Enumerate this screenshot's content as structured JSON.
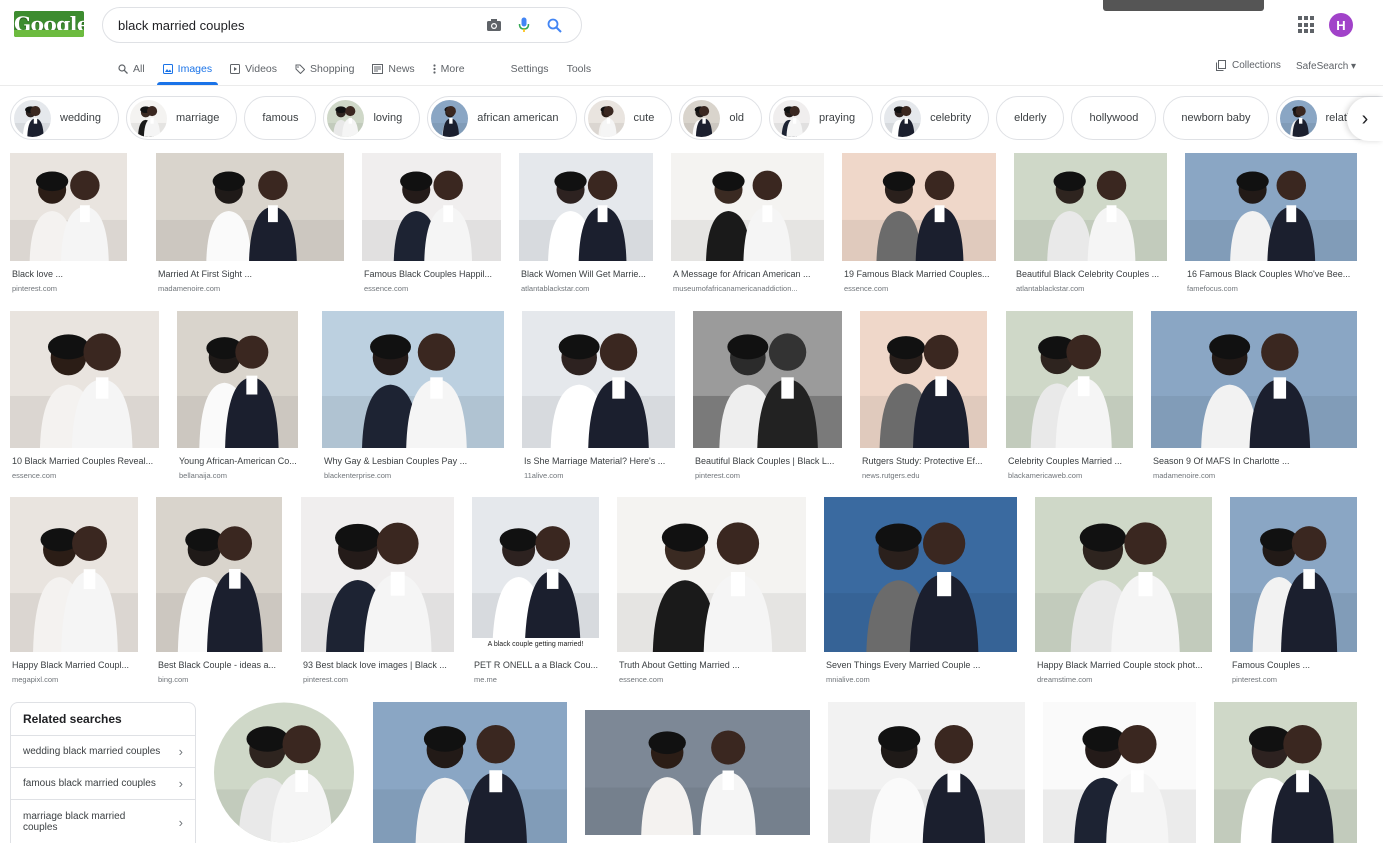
{
  "logo_text": "Google",
  "search": {
    "query": "black married couples"
  },
  "avatar_letter": "H",
  "tabs": [
    {
      "label": "All",
      "icon": "search-icon"
    },
    {
      "label": "Images",
      "icon": "image-icon"
    },
    {
      "label": "Videos",
      "icon": "video-icon"
    },
    {
      "label": "Shopping",
      "icon": "tag-icon"
    },
    {
      "label": "News",
      "icon": "news-icon"
    },
    {
      "label": "More",
      "icon": "more-icon"
    },
    {
      "label": "Settings"
    },
    {
      "label": "Tools"
    }
  ],
  "toolbar": {
    "collections": "Collections",
    "safesearch": "SafeSearch ▾"
  },
  "chips": [
    {
      "label": "wedding",
      "thumb": true
    },
    {
      "label": "marriage",
      "thumb": true
    },
    {
      "label": "famous",
      "thumb": false
    },
    {
      "label": "loving",
      "thumb": true
    },
    {
      "label": "african american",
      "thumb": true
    },
    {
      "label": "cute",
      "thumb": true
    },
    {
      "label": "old",
      "thumb": true
    },
    {
      "label": "praying",
      "thumb": true
    },
    {
      "label": "celebrity",
      "thumb": true
    },
    {
      "label": "elderly",
      "thumb": false
    },
    {
      "label": "hollywood",
      "thumb": false
    },
    {
      "label": "newborn baby",
      "thumb": false
    },
    {
      "label": "relationship",
      "thumb": true
    }
  ],
  "results": [
    {
      "caption": "Black love ...",
      "source": "pinterest.com"
    },
    {
      "caption": "Married At First Sight ...",
      "source": "madamenoire.com"
    },
    {
      "caption": "Famous Black Couples Happil...",
      "source": "essence.com"
    },
    {
      "caption": "Black Women Will Get Marrie...",
      "source": "atlantablackstar.com"
    },
    {
      "caption": "A Message for African American ...",
      "source": "museumofafricanamericanaddiction..."
    },
    {
      "caption": "19 Famous Black Married Couples...",
      "source": "essence.com"
    },
    {
      "caption": "Beautiful Black Celebrity Couples ...",
      "source": "atlantablackstar.com"
    },
    {
      "caption": "16 Famous Black Couples Who've Bee...",
      "source": "famefocus.com"
    },
    {
      "caption": "10 Black Married Couples Reveal...",
      "source": "essence.com"
    },
    {
      "caption": "Young African-American Co...",
      "source": "bellanaija.com"
    },
    {
      "caption": "Why Gay & Lesbian Couples Pay ...",
      "source": "blackenterprise.com"
    },
    {
      "caption": "Is She Marriage Material? Here's ...",
      "source": "11alive.com"
    },
    {
      "caption": "Beautiful Black Couples | Black L...",
      "source": "pinterest.com"
    },
    {
      "caption": "Rutgers Study: Protective Ef...",
      "source": "news.rutgers.edu"
    },
    {
      "caption": "Celebrity Couples Married ...",
      "source": "blackamericaweb.com"
    },
    {
      "caption": "Season 9 Of MAFS In Charlotte ...",
      "source": "madamenoire.com"
    },
    {
      "caption": "Happy Black Married Coupl...",
      "source": "megapixl.com"
    },
    {
      "caption": "Best Black Couple - ideas a...",
      "source": "bing.com"
    },
    {
      "caption": "93 Best black love images | Black ...",
      "source": "pinterest.com"
    },
    {
      "caption": "PET R ONELL a a Black Cou...",
      "source": "me.me"
    },
    {
      "caption": "Truth About Getting Married ...",
      "source": "essence.com"
    },
    {
      "caption": "Seven Things Every Married Couple ...",
      "source": "mnialive.com"
    },
    {
      "caption": "Happy Black Married Couple stock phot...",
      "source": "dreamstime.com"
    },
    {
      "caption": "Famous Couples ...",
      "source": "pinterest.com"
    }
  ],
  "image_overlay_text": "A black couple getting married!",
  "related": {
    "title": "Related searches",
    "items": [
      "wedding black married couples",
      "famous black married couples",
      "marriage black married couples"
    ]
  },
  "colors": {
    "accent": "#1a73e8",
    "avatar": "#a142c9",
    "text_secondary": "#5f6368"
  }
}
